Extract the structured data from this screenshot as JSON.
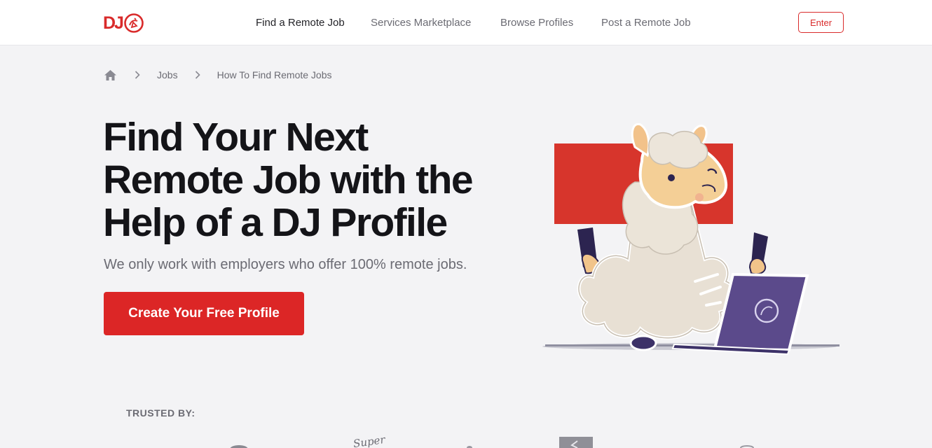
{
  "header": {
    "logo_text": "DJ",
    "nav": [
      {
        "label": "Find a Remote Job",
        "active": true
      },
      {
        "label": "Services Marketplace",
        "active": false
      },
      {
        "label": "Browse Profiles",
        "active": false
      },
      {
        "label": "Post a Remote Job",
        "active": false
      }
    ],
    "enter_label": "Enter"
  },
  "breadcrumb": {
    "home_icon": "home-icon",
    "separator_icon": "chevron-right-icon",
    "items": [
      "Jobs",
      "How To Find Remote Jobs"
    ]
  },
  "hero": {
    "title_lines": [
      "Find Your Next",
      "Remote Job with the",
      "Help of a DJ Profile"
    ],
    "subtitle": "We only work with employers who offer 100% remote jobs.",
    "cta_label": "Create Your Free Profile",
    "illustration": "llama-working-on-laptop"
  },
  "trusted": {
    "label": "TRUSTED BY:",
    "logo_text": "Super"
  },
  "colors": {
    "brand_red": "#dc2626",
    "background": "#f3f3f5",
    "text_dark": "#141418",
    "text_muted": "#6b6b73",
    "laptop_purple": "#5b4a8b"
  }
}
